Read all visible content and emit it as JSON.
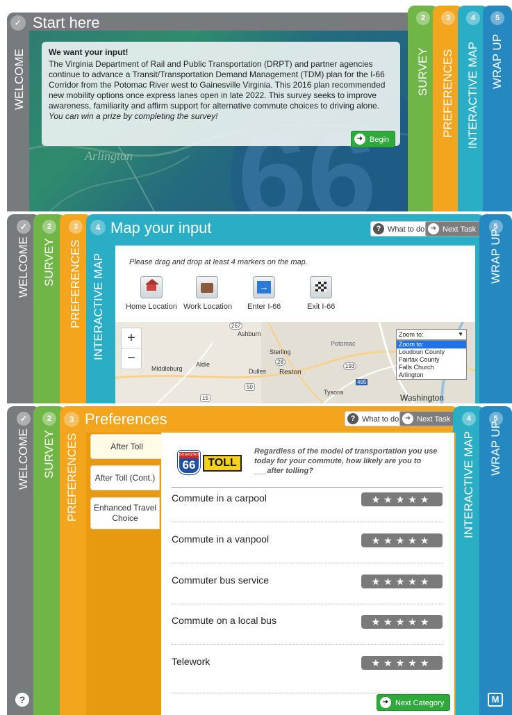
{
  "colors": {
    "welcome": "#777b7e",
    "survey": "#70b646",
    "preferences": "#f3a51d",
    "map": "#2aaec6",
    "wrapup": "#2688c0",
    "green": "#2fa93c"
  },
  "tabs": {
    "welcome": "WELCOME",
    "survey": "SURVEY",
    "preferences": "PREFERENCES",
    "map": "INTERACTIVE MAP",
    "wrapup": "WRAP UP",
    "n2": "2",
    "n3": "3",
    "n4": "4",
    "n5": "5",
    "check": "✓"
  },
  "welcome": {
    "title": "Start here",
    "heading": "We want your input!",
    "body": "The Virginia Department of Rail and Public Transportation (DRPT) and partner agencies continue to advance a Transit/Transportation Demand Management (TDM) plan for the I-66 Corridor from the Potomac River west to Gainesville Virginia. This 2016 plan recommended new mobility options once express lanes open in late 2022. This survey seeks to improve awareness, familiarity and affirm support for alternative commute choices to driving alone.",
    "body_em": "You can win a prize by completing the survey!",
    "begin": "Begin",
    "bg_text": "Arlington",
    "bg_number": "66"
  },
  "map": {
    "title": "Map your input",
    "what_to_do": "What to do",
    "next_task": "Next Task",
    "instruction": "Please drag and drop at least 4 markers on the map.",
    "markers": [
      {
        "label": "Home Location",
        "icon": "home-icon"
      },
      {
        "label": "Work Location",
        "icon": "briefcase-icon"
      },
      {
        "label": "Enter I-66",
        "icon": "enter-arrow-icon"
      },
      {
        "label": "Exit I-66",
        "icon": "checkered-flag-icon"
      }
    ],
    "zoom_in": "+",
    "zoom_out": "−",
    "zoom_select": "Zoom to:",
    "zoom_options": [
      "Zoom to:",
      "Loudoun County",
      "Fairfax County",
      "Falls Church",
      "Arlington"
    ],
    "places": {
      "ashburn": "Ashburn",
      "sterling": "Sterling",
      "potomac": "Potomac",
      "middleburg": "Middleburg",
      "aldie": "Aldie",
      "dulles": "Dulles",
      "reston": "Reston",
      "tysons": "Tysons",
      "washington": "Washington",
      "r267": "267",
      "r28": "28",
      "r50": "50",
      "r15": "15",
      "r193": "193",
      "r495": "495"
    }
  },
  "prefs": {
    "title": "Preferences",
    "what_to_do": "What to do",
    "next_task": "Next Task",
    "categories": [
      "After Toll",
      "After Toll (Cont.)",
      "Enhanced Travel Choice"
    ],
    "question": "Regardless of the model of transportation you use today for your commute, how likely are you to ___after tolling?",
    "shield": {
      "top": "INTERSTATE",
      "num": "66",
      "toll": "TOLL"
    },
    "rows": [
      "Commute in a carpool",
      "Commute in a vanpool",
      "Commuter bus service",
      "Commute on a local bus",
      "Telework"
    ],
    "stars": "★★★★★",
    "next_category": "Next Category",
    "help": "?",
    "logo": "M"
  }
}
